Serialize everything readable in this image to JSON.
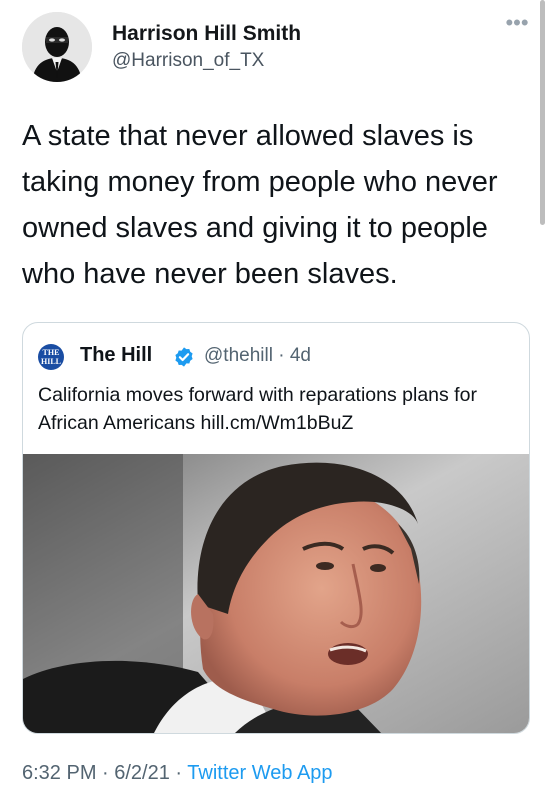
{
  "author": {
    "display_name": "Harrison Hill Smith",
    "handle": "@Harrison_of_TX",
    "avatar_icon": "masked-man-silhouette-icon"
  },
  "more_icon": "more-dots-icon",
  "tweet": {
    "text": "A state that never allowed slaves is taking money from people who never owned slaves and giving it to people who have never been slaves."
  },
  "quoted_tweet": {
    "logo_text": "THE HILL",
    "name": "The Hill",
    "verified_icon": "verified-badge-icon",
    "handle_time": "@thehill · 4d",
    "text": "California moves forward with reparations plans for African Americans hill.cm/Wm1bBuZ",
    "image_icon": "news-photo-man-speaking"
  },
  "footer": {
    "time_date": "6:32 PM · 6/2/21 · ",
    "source": "Twitter Web App"
  },
  "colors": {
    "link": "#1d9bf0",
    "muted": "#536471",
    "border": "#cfd9de",
    "hill_blue": "#1a4da3"
  }
}
